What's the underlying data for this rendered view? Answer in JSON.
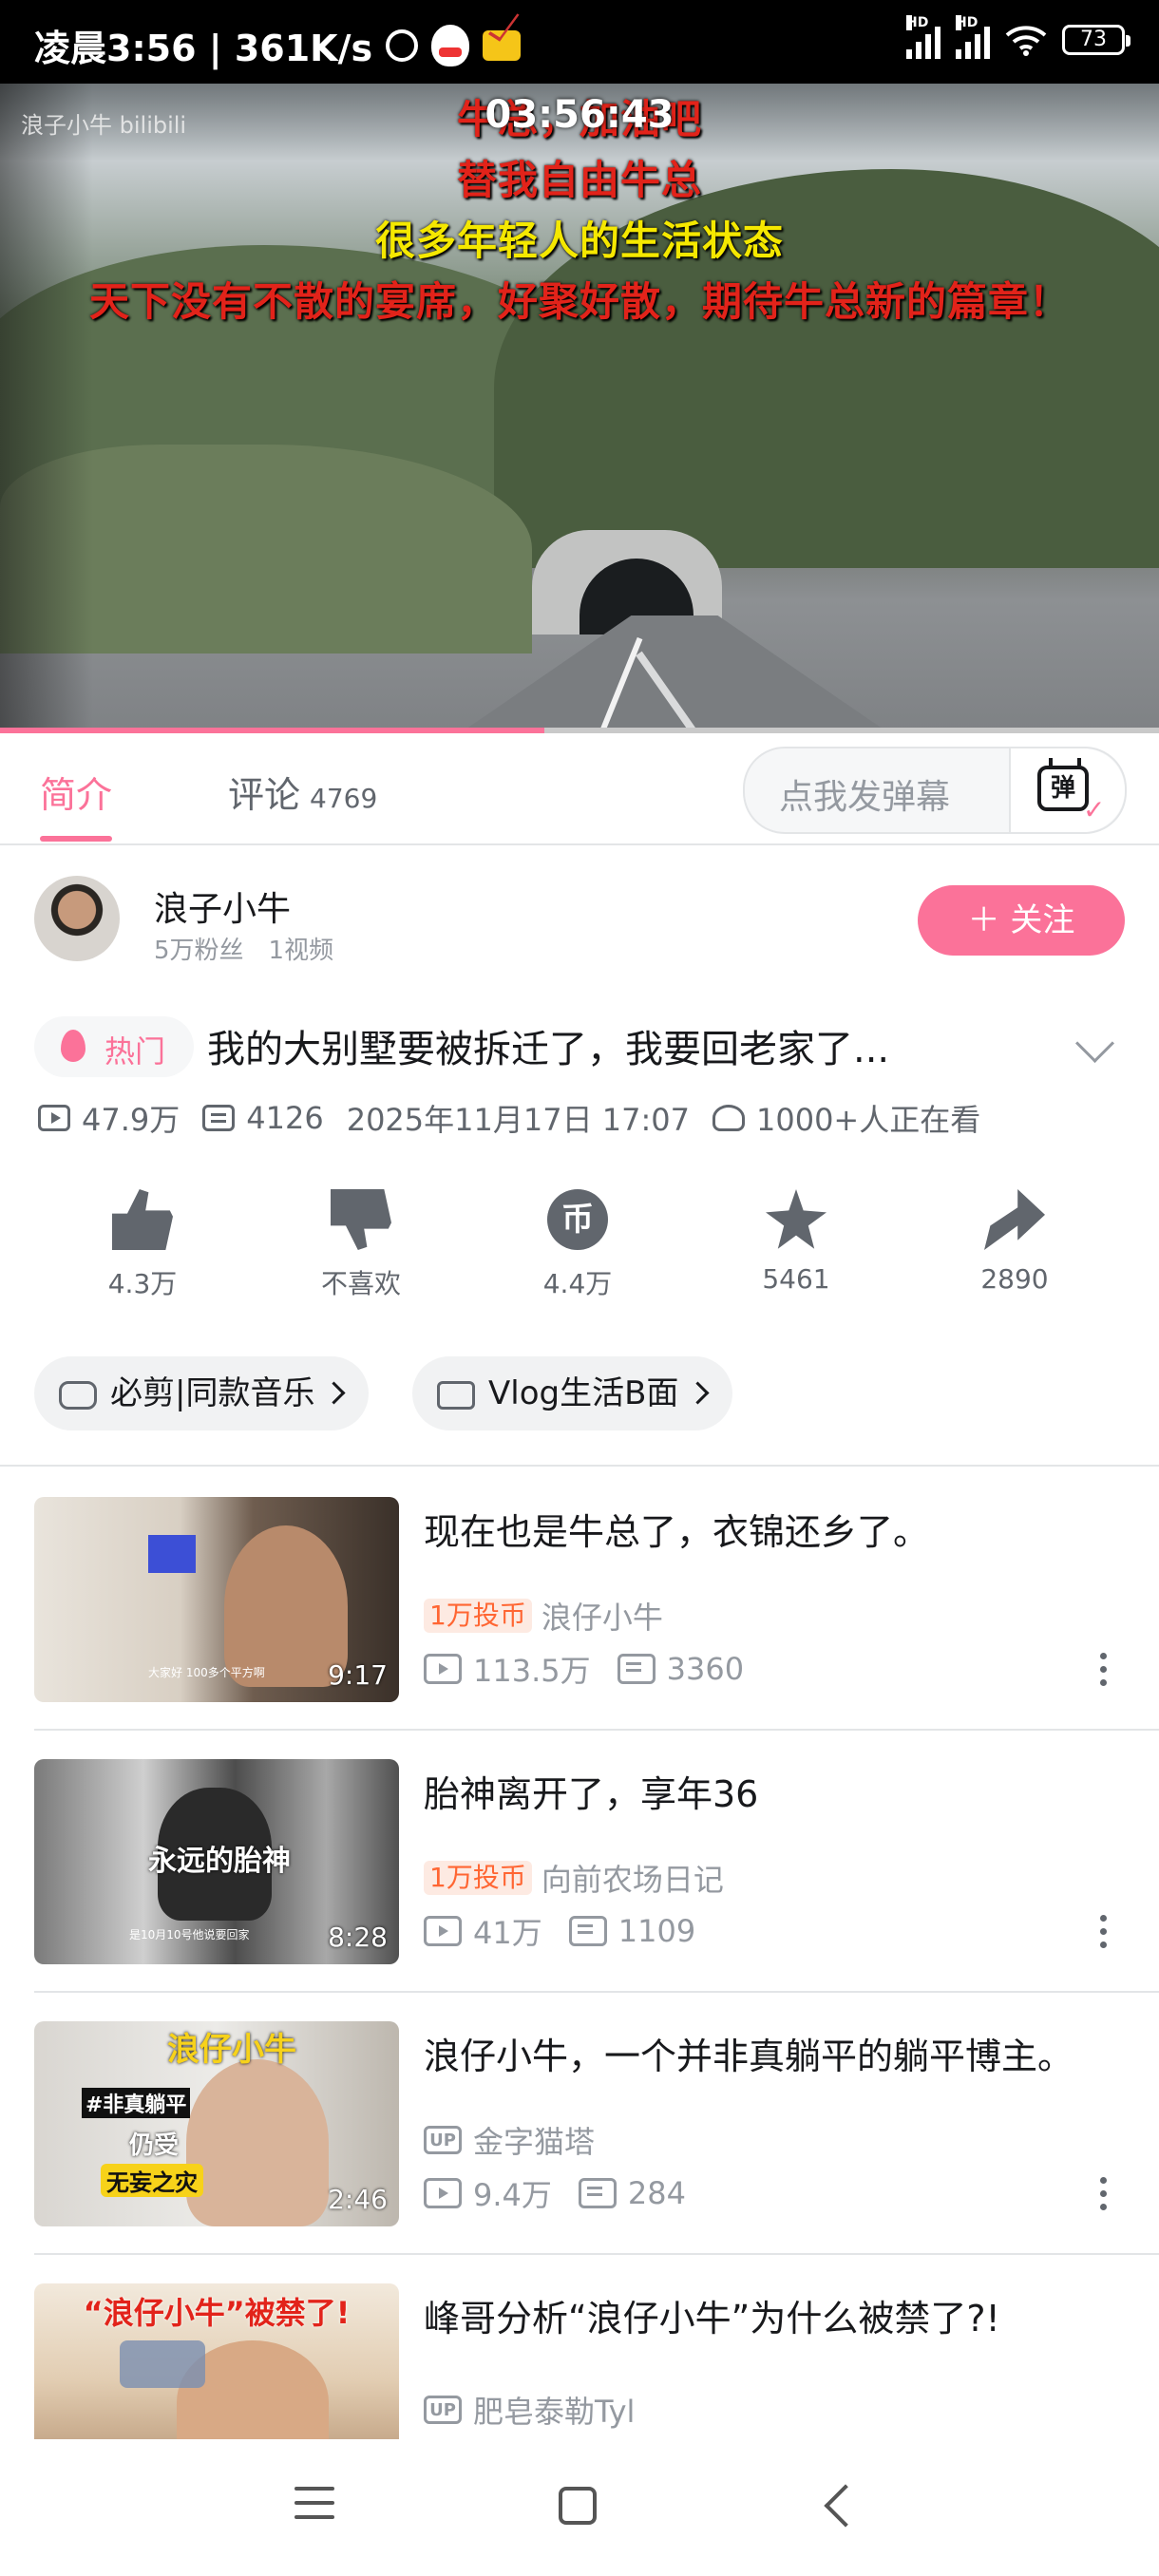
{
  "status_bar": {
    "time_speed": "凌晨3:56 | 361K/s",
    "battery": "73",
    "hd1": "HD",
    "hd2": "HD"
  },
  "video": {
    "watermark": "浪子小牛 bilibili",
    "timecode": "03:56:43",
    "subtitle_1": "牛总，加油吧",
    "subtitle_2": "替我自由牛总",
    "subtitle_3": "很多年轻人的生活状态",
    "subtitle_4": "天下没有不散的宴席，好聚好散，期待牛总新的篇章！",
    "progress": 0.47
  },
  "tabs": {
    "intro": "简介",
    "comments": "评论",
    "comments_count": "4769",
    "danmu_placeholder": "点我发弹幕",
    "danmu_button_char": "弹"
  },
  "uploader": {
    "name": "浪子小牛",
    "meta": "5万粉丝　1视频",
    "follow": "＋ 关注"
  },
  "video_info": {
    "hot_badge": "热门",
    "title": "我的大别墅要被拆迁了，我要回老家了...",
    "views": "47.9万",
    "danmaku": "4126",
    "date": "2025年11月17日 17:07",
    "watching": "1000+人正在看"
  },
  "actions": {
    "like": "4.3万",
    "dislike": "不喜欢",
    "coin": "4.4万",
    "coin_glyph": "币",
    "favorite": "5461",
    "share": "2890"
  },
  "tags": {
    "music": "必剪|同款音乐",
    "vlog": "Vlog生活B面"
  },
  "recommendations": [
    {
      "title": "现在也是牛总了，衣锦还乡了。",
      "badge": "1万投币",
      "author": "浪仔小牛",
      "views": "113.5万",
      "danmaku": "3360",
      "duration": "9:17",
      "thumb_caption": "大家好 100多个平方啊"
    },
    {
      "title": "胎神离开了，享年36",
      "badge": "1万投币",
      "author": "向前农场日记",
      "views": "41万",
      "danmaku": "1109",
      "duration": "8:28",
      "thumb_caption": "永远的胎神",
      "thumb_subcaption": "是10月10号他说要回家"
    },
    {
      "title": "浪仔小牛，一个并非真躺平的躺平博主。",
      "badge": "UP",
      "author": "金字猫塔",
      "views": "9.4万",
      "danmaku": "284",
      "duration": "2:46",
      "thumb_caption": "浪仔小牛",
      "thumb_tag1": "#非真躺平",
      "thumb_tag2": "仍受",
      "thumb_tag3": "无妄之灾"
    },
    {
      "title": "峰哥分析“浪仔小牛”为什么被禁了?!",
      "badge": "UP",
      "author": "肥皂泰勒Tyl",
      "thumb_caption": "“浪仔小牛”被禁了!"
    }
  ]
}
